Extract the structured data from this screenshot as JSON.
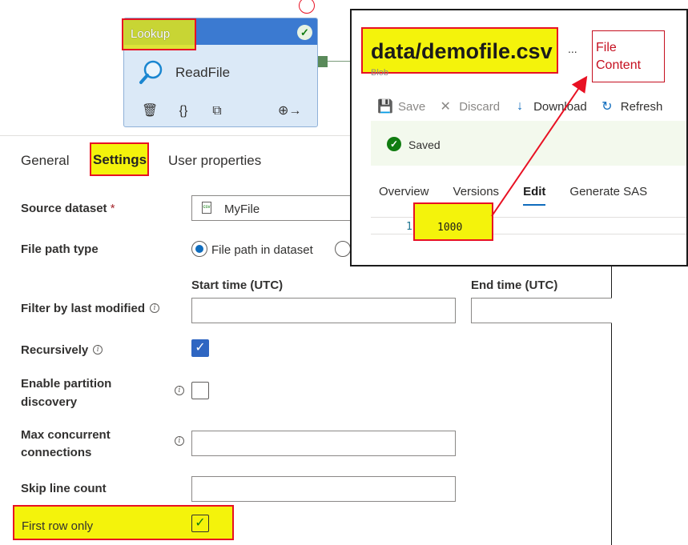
{
  "activity": {
    "type_label": "Lookup",
    "name": "ReadFile"
  },
  "tabs": [
    {
      "label": "General"
    },
    {
      "label": "Settings"
    },
    {
      "label": "User properties"
    }
  ],
  "form": {
    "source_dataset": {
      "label": "Source dataset",
      "required_mark": "*",
      "value": "MyFile"
    },
    "file_path_type": {
      "label": "File path type",
      "option_selected": "File path in dataset"
    },
    "filter_modified": {
      "label": "Filter by last modified",
      "start_label": "Start time (UTC)",
      "end_label": "End time (UTC)"
    },
    "recursively": {
      "label": "Recursively",
      "checked": true
    },
    "partition": {
      "label_line1": "Enable partition",
      "label_line2": "discovery",
      "checked": false
    },
    "max_conn": {
      "label_line1": "Max concurrent",
      "label_line2": "connections"
    },
    "skip_lines": {
      "label": "Skip line count"
    },
    "first_row": {
      "label": "First row only",
      "checked": true
    }
  },
  "blob": {
    "title": "data/demofile.csv",
    "subtitle": "Blob",
    "more": "...",
    "note": "File Content",
    "toolbar": {
      "save": "Save",
      "discard": "Discard",
      "download": "Download",
      "refresh": "Refresh"
    },
    "status": "Saved",
    "tabs": [
      "Overview",
      "Versions",
      "Edit",
      "Generate SAS"
    ],
    "selected_tab": "Edit",
    "line_number": "1",
    "line_content": "1000"
  },
  "colors": {
    "highlight": "#f4f30b",
    "callout_red": "#e81123",
    "accent_blue": "#0f6cbd",
    "success_green": "#107c10"
  }
}
